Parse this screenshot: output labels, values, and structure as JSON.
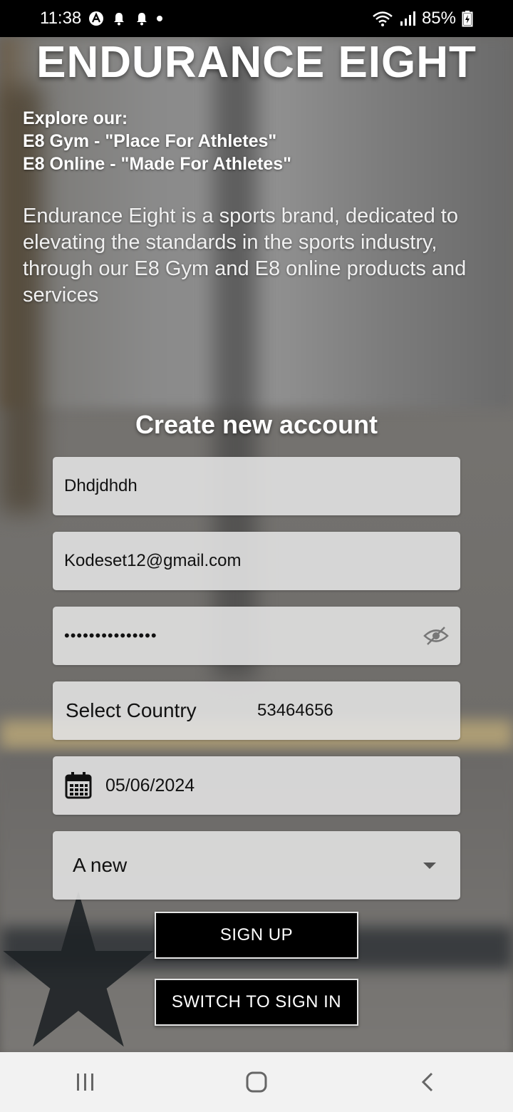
{
  "status_bar": {
    "time": "11:38",
    "battery": "85%",
    "icons": [
      "app-notification-icon",
      "bell-icon",
      "bell-icon",
      "dot",
      "wifi-icon",
      "signal-icon",
      "battery-icon"
    ]
  },
  "header": {
    "brand": "ENDURANCE EIGHT",
    "explore_lines": [
      "Explore our:",
      "E8 Gym - \"Place For Athletes\"",
      "E8 Online - \"Made For Athletes\""
    ],
    "about": "Endurance Eight is a sports brand, dedicated to elevating the standards in the sports industry, through our E8 Gym and E8 online products and services"
  },
  "form": {
    "title": "Create new account",
    "name_value": "Dhdjdhdh",
    "email_value": "Kodeset12@gmail.com",
    "password_masked": "•••••••••••••••",
    "country_label": "Select Country",
    "phone_value": "53464656",
    "date_value": "05/06/2024",
    "select_value": "A new"
  },
  "buttons": {
    "sign_up": "SIGN UP",
    "switch_sign_in": "SWITCH TO SIGN IN"
  },
  "nav_bar": {
    "icons": [
      "recent-apps-icon",
      "home-icon",
      "back-icon"
    ]
  }
}
